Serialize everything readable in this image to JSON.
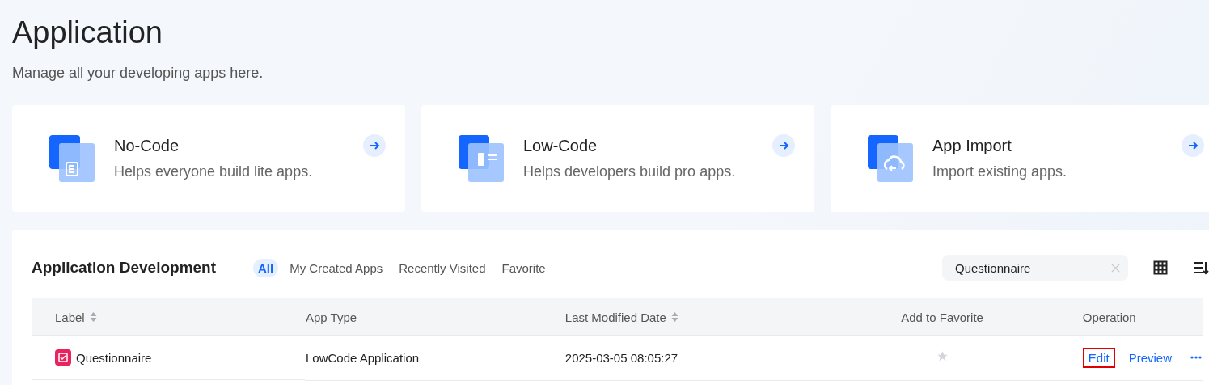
{
  "header": {
    "title": "Application",
    "subtitle": "Manage all your developing apps here."
  },
  "cards": [
    {
      "kind": "nocode",
      "title": "No-Code",
      "description": "Helps everyone build lite apps."
    },
    {
      "kind": "lowcode",
      "title": "Low-Code",
      "description": "Helps developers build pro apps."
    },
    {
      "kind": "import",
      "title": "App Import",
      "description": "Import existing apps."
    }
  ],
  "panel": {
    "title": "Application Development",
    "tabs": [
      {
        "label": "All",
        "selected": true
      },
      {
        "label": "My Created Apps",
        "selected": false
      },
      {
        "label": "Recently Visited",
        "selected": false
      },
      {
        "label": "Favorite",
        "selected": false
      }
    ],
    "search": {
      "value": "Questionnaire"
    },
    "table": {
      "columns": [
        {
          "label": "Label",
          "sortable": true
        },
        {
          "label": "App Type",
          "sortable": false
        },
        {
          "label": "Last Modified Date",
          "sortable": true
        },
        {
          "label": "Add to Favorite",
          "sortable": false
        },
        {
          "label": "Operation",
          "sortable": false
        }
      ],
      "rows": [
        {
          "label": "Questionnaire",
          "app_type": "LowCode Application",
          "modified": "2025-03-05 08:05:27",
          "favorite": false,
          "actions": [
            {
              "label": "Edit",
              "highlighted": true
            },
            {
              "label": "Preview",
              "highlighted": false
            }
          ]
        }
      ]
    }
  }
}
